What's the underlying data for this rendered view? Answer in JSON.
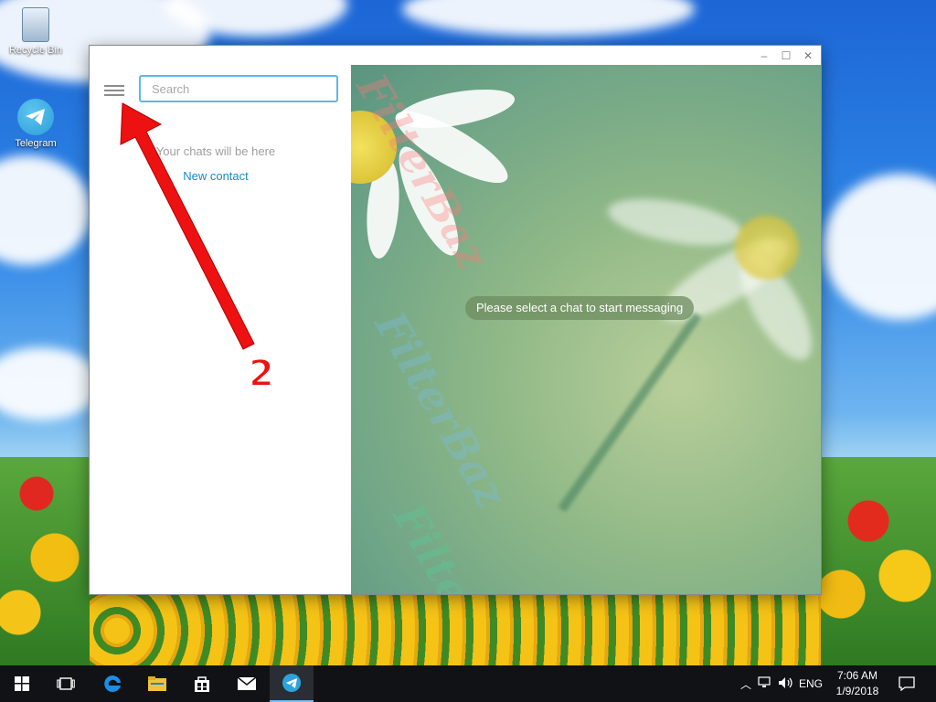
{
  "desktop": {
    "icons": [
      {
        "label": "Recycle Bin",
        "icon": "recycle-bin-icon"
      },
      {
        "label": "Telegram",
        "icon": "telegram-icon"
      }
    ]
  },
  "window": {
    "controls": {
      "minimize": "–",
      "maximize": "☐",
      "close": "✕"
    },
    "sidebar": {
      "menu_icon": "hamburger-menu-icon",
      "search_placeholder": "Search",
      "empty_text": "Your chats will be here",
      "new_contact": "New contact"
    },
    "chat": {
      "placeholder": "Please select a chat to start messaging"
    },
    "watermark": "FilterBaz"
  },
  "annotation": {
    "step_number": "2",
    "arrow_color": "#ee1111"
  },
  "taskbar": {
    "apps": [
      "windows-start-icon",
      "task-view-icon",
      "edge-icon",
      "file-explorer-icon",
      "store-icon",
      "mail-icon",
      "telegram-icon"
    ],
    "tray": {
      "language": "ENG"
    },
    "clock": {
      "time": "7:06 AM",
      "date": "1/9/2018"
    }
  },
  "colors": {
    "accent": "#5eb7e7",
    "link": "#168acd",
    "taskbar": "#101216"
  }
}
